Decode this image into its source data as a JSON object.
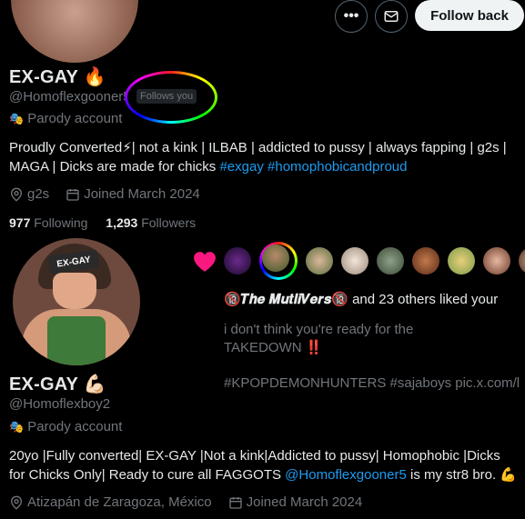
{
  "profile1": {
    "name": "EX-GAY",
    "name_emoji": "🔥",
    "handle": "@Homoflexgooner5",
    "follows_you": "Follows you",
    "parody": "Parody account",
    "bio_text": "Proudly Converted⚡| not a kink | ILBAB | addicted to pussy | always fapping | g2s | MAGA | Dicks are made for chicks ",
    "bio_tag1": "#exgay",
    "bio_tag2": "#homophobicandproud",
    "location": "g2s",
    "joined": "Joined March 2024",
    "following_count": "977",
    "following_label": "Following",
    "followers_count": "1,293",
    "followers_label": "Followers",
    "follow_back": "Follow back"
  },
  "overlay": {
    "liked_names": "🔞𝑻𝒉𝒆 𝑴𝒖𝒕𝒍𝒊𝑽𝒆𝒓𝒔🔞",
    "liked_rest": " and 23 others liked your",
    "post_line1": "i don't think you're ready for the",
    "post_line2": "TAKEDOWN ‼️",
    "post_tags": "#KPOPDEMONHUNTERS #sajaboys pic.x.com/l"
  },
  "profile2": {
    "avatar_label": "EX-GAY",
    "name": "EX-GAY",
    "name_emoji": "💪🏻",
    "handle": "@Homoflexboy2",
    "parody": "Parody account",
    "bio_line1": "20yo |Fully converted| EX-GAY |Not a kink|Addicted to pussy| Homophobic |Dicks",
    "bio_line2_pre": "for Chicks Only| Ready to cure all FAGGOTS ",
    "bio_mention": "@Homoflexgooner5",
    "bio_line2_post": " is my str8 bro. 💪",
    "location": "Atizapán de Zaragoza, México",
    "joined": "Joined March 2024"
  },
  "colors": {
    "accent": "#1d9bf0",
    "muted": "#71767b",
    "heart": "#f91880"
  }
}
